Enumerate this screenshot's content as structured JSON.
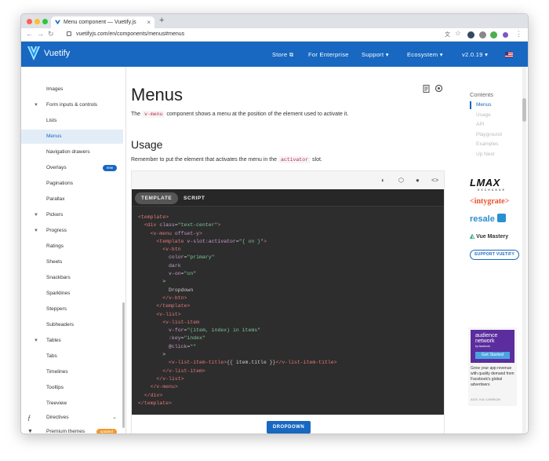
{
  "browser": {
    "tab_title": "Menu component — Vuetify.js",
    "url": "vuetifyjs.com/en/components/menus#menus"
  },
  "appbar": {
    "brand": "Vuetify",
    "store": "Store",
    "enterprise": "For Enterprise",
    "support": "Support",
    "ecosystem": "Ecosystem",
    "version": "v2.0.19"
  },
  "sidebar": {
    "items": [
      {
        "label": "Images"
      },
      {
        "label": "Form inputs & controls"
      },
      {
        "label": "Lists"
      },
      {
        "label": "Menus"
      },
      {
        "label": "Navigation drawers"
      },
      {
        "label": "Overlays",
        "badge": "new"
      },
      {
        "label": "Paginations"
      },
      {
        "label": "Parallax"
      },
      {
        "label": "Pickers"
      },
      {
        "label": "Progress"
      },
      {
        "label": "Ratings"
      },
      {
        "label": "Sheets"
      },
      {
        "label": "Snackbars"
      },
      {
        "label": "Sparklines"
      },
      {
        "label": "Steppers"
      },
      {
        "label": "Subheaders"
      },
      {
        "label": "Tables"
      },
      {
        "label": "Tabs"
      },
      {
        "label": "Timelines"
      },
      {
        "label": "Tooltips"
      },
      {
        "label": "Treeview"
      },
      {
        "label": "Directives"
      },
      {
        "label": "Premium themes",
        "badge": "updated"
      }
    ]
  },
  "main": {
    "title": "Menus",
    "intro_pre": "The",
    "intro_code": "v-menu",
    "intro_post": "component shows a menu at the position of the element used to activate it.",
    "usage_title": "Usage",
    "usage_pre": "Remember to put the element that activates the menu in the",
    "usage_code": "activator",
    "usage_post": "slot.",
    "tabs": [
      "TEMPLATE",
      "SCRIPT"
    ],
    "dropdown_button": "DROPDOWN"
  },
  "toc": {
    "title": "Contents",
    "items": [
      "Menus",
      "Usage",
      "API",
      "Playground",
      "Examples",
      "Up Next"
    ]
  },
  "sponsors": {
    "lmax": "LMAX",
    "lmax_sub": "EXCHANGE",
    "intygrate": "<intygrate>",
    "resale": "resale",
    "vuemastery": "Vue Mastery",
    "support_button": "SUPPORT VUETIFY"
  },
  "ad": {
    "brand_line1": "audience",
    "brand_line2": "network",
    "brand_line3": "by facebook",
    "cta": "Get Started",
    "text": "Grow your app revenue with quality demand from Facebook's global advertisers",
    "footer": "ADS VIA CARBON"
  },
  "colors": {
    "primary": "#1867c0",
    "code_bg": "#2d2d2d",
    "badge_new": "#1867c0",
    "badge_updated": "#f19a2e"
  }
}
